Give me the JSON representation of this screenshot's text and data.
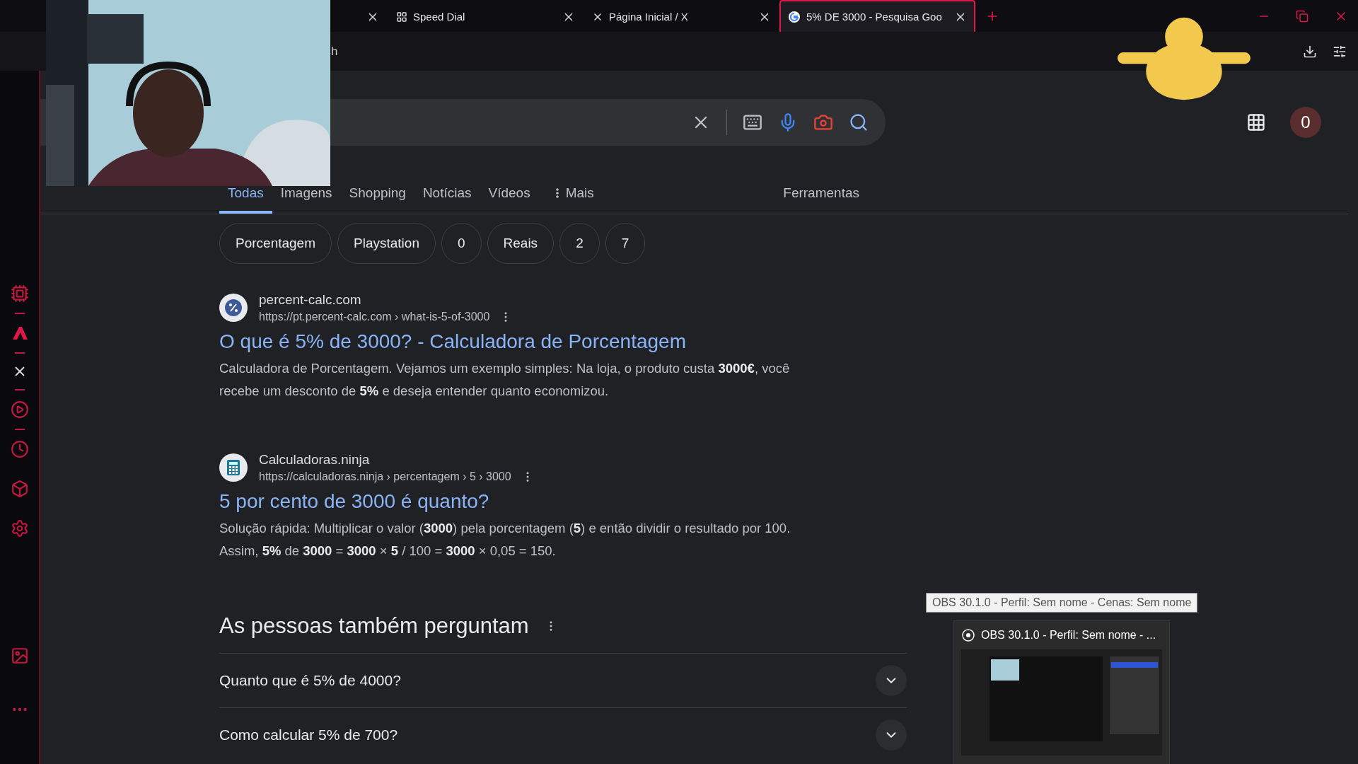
{
  "browser_tabs": [
    {
      "kind": "covered",
      "selected": false
    },
    {
      "kind": "page",
      "label": "Speed Dial",
      "selected": false
    },
    {
      "kind": "page",
      "label": "Página Inicial / X",
      "selected": false
    },
    {
      "kind": "page",
      "label": "5% DE 3000 - Pesquisa Goo",
      "selected": true
    }
  ],
  "address_bar": {
    "value": "h"
  },
  "account_initial": "0",
  "search_tabs": [
    {
      "label": "Todas",
      "selected": true
    },
    {
      "label": "Imagens",
      "selected": false
    },
    {
      "label": "Shopping",
      "selected": false
    },
    {
      "label": "Notícias",
      "selected": false
    },
    {
      "label": "Vídeos",
      "selected": false
    },
    {
      "label": "Mais",
      "selected": false
    }
  ],
  "tools_label": "Ferramentas",
  "chips": [
    "Porcentagem",
    "Playstation",
    "0",
    "Reais",
    "2",
    "7"
  ],
  "results": [
    {
      "site": "percent-calc.com",
      "url": "https://pt.percent-calc.com › what-is-5-of-3000",
      "title": "O que é 5% de 3000? - Calculadora de Porcentagem",
      "snippet": "Calculadora de Porcentagem. Vejamos um exemplo simples: Na loja, o produto custa **3000€**, você recebe um desconto de **5%** e deseja entender quanto economizou."
    },
    {
      "site": "Calculadoras.ninja",
      "url": "https://calculadoras.ninja › percentagem › 5 › 3000",
      "title": "5 por cento de 3000 é quanto?",
      "snippet": "Solução rápida: Multiplicar o valor (**3000**) pela porcentagem (**5**) e então dividir o resultado por 100. Assim, **5%** de **3000** = **3000** × **5** / 100 = **3000** × 0,05 = 150."
    }
  ],
  "people_also_ask": {
    "heading": "As pessoas também perguntam",
    "questions": [
      {
        "text": "Quanto que é 5% de 4000?",
        "expanded": false
      },
      {
        "text": "Como calcular 5% de 700?",
        "expanded": false
      }
    ]
  },
  "taskbar_preview": {
    "tooltip": "OBS 30.1.0 - Perfil: Sem nome - Cenas: Sem nome",
    "title": "OBS 30.1.0 - Perfil: Sem nome - ..."
  }
}
